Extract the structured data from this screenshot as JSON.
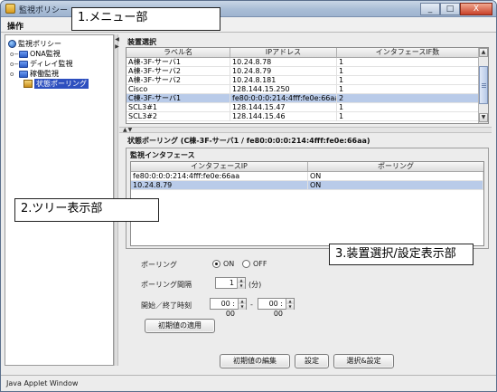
{
  "window": {
    "title": "監視ポリシー",
    "minimize": "_",
    "maximize": "□",
    "close": "X"
  },
  "menu": {
    "items": [
      "操作"
    ]
  },
  "callouts": {
    "menu": "1.メニュー部",
    "tree": "2.ツリー表示部",
    "settings": "3.装置選択/設定表示部"
  },
  "tree": {
    "root": "監視ポリシー",
    "nodes": [
      {
        "label": "ONA監視",
        "expander": "o−"
      },
      {
        "label": "ディレイ監視",
        "expander": "o−"
      },
      {
        "label": "稼働監視",
        "expander": "o"
      },
      {
        "label": "状態ポーリング",
        "expander": ""
      }
    ]
  },
  "device_selection": {
    "title": "装置選択",
    "columns": [
      "ラベル名",
      "IPアドレス",
      "インタフェースIF数"
    ],
    "rows": [
      {
        "label": "A棟-3F-サーバ1",
        "ip": "10.24.8.78",
        "count": "1"
      },
      {
        "label": "A棟-3F-サーバ2",
        "ip": "10.24.8.79",
        "count": "1"
      },
      {
        "label": "A棟-3F-サーバ2",
        "ip": "10.24.8.181",
        "count": "1"
      },
      {
        "label": "Cisco",
        "ip": "128.144.15.250",
        "count": "1"
      },
      {
        "label": "C棟-3F-サーバ1",
        "ip": "fe80:0:0:0:214:4fff:fe0e:66aa",
        "count": "2"
      },
      {
        "label": "SCL3#1",
        "ip": "128.144.15.47",
        "count": "1"
      },
      {
        "label": "SCL3#2",
        "ip": "128.144.15.46",
        "count": "1"
      }
    ],
    "selected_row": 4,
    "scroll_up": "▲",
    "scroll_down": "▼"
  },
  "polling": {
    "title": "状態ポーリング (C棟-3F-サーバ1 / fe80:0:0:0:214:4fff:fe0e:66aa)",
    "iface_group_title": "監視インタフェース",
    "iface_columns": [
      "インタフェースIP",
      "ポーリング"
    ],
    "iface_rows": [
      {
        "ip": "fe80:0:0:0:214:4fff:fe0e:66aa",
        "polling": "ON"
      },
      {
        "ip": "10.24.8.79",
        "polling": "ON"
      }
    ],
    "selected_iface": 1,
    "polling_label": "ポーリング",
    "on_label": "ON",
    "off_label": "OFF",
    "polling_state": "ON",
    "interval_label": "ポーリング間隔",
    "interval_value": "1",
    "interval_unit": "(分)",
    "time_label": "開始／終了時刻",
    "start_time": "00 : 00",
    "end_time": "00 : 00",
    "time_sep": "-",
    "apply_default_btn": "初期値の適用"
  },
  "footer_buttons": {
    "edit_default": "初期値の編集",
    "set": "設定",
    "select_set": "選択&設定"
  },
  "status_bar": {
    "text": "Java Applet Window"
  }
}
